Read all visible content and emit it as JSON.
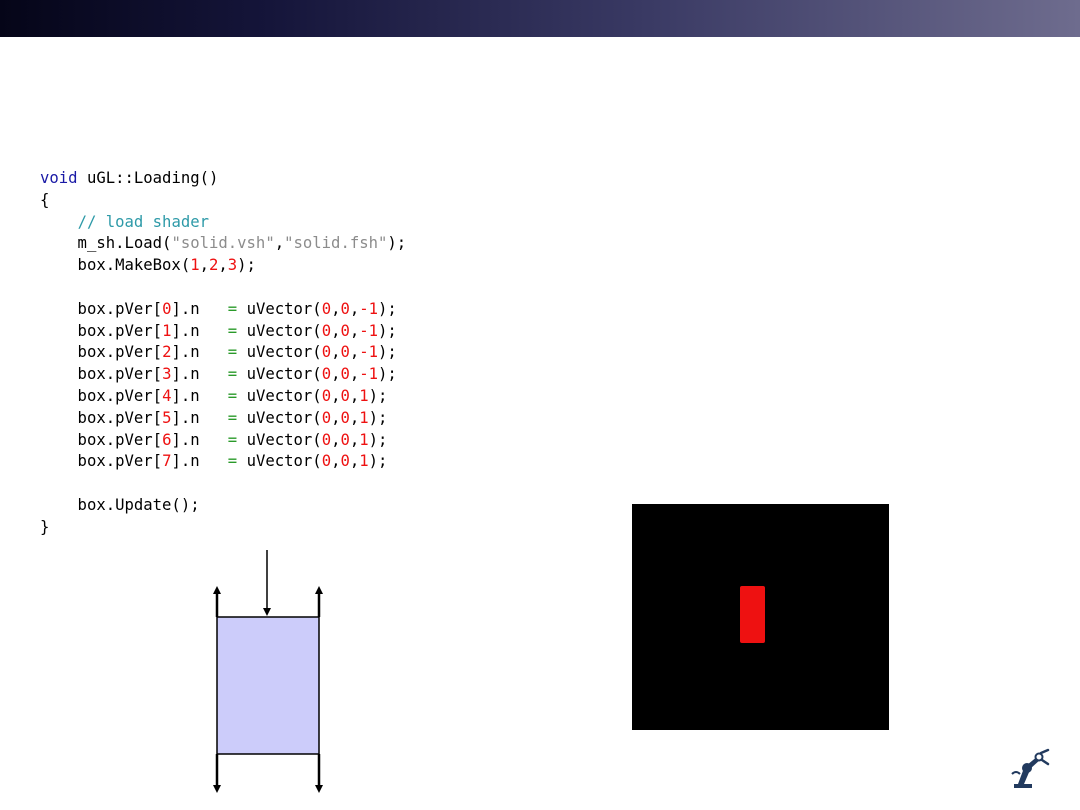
{
  "code": {
    "lines": [
      [
        {
          "t": "void",
          "c": "keyword"
        },
        {
          "t": " uGL::Loading()",
          "c": "plain"
        }
      ],
      [
        {
          "t": "{",
          "c": "plain"
        }
      ],
      [
        {
          "t": "    ",
          "c": "plain"
        },
        {
          "t": "// load shader",
          "c": "comment"
        }
      ],
      [
        {
          "t": "    m_sh.Load(",
          "c": "plain"
        },
        {
          "t": "\"solid.vsh\"",
          "c": "string"
        },
        {
          "t": ",",
          "c": "plain"
        },
        {
          "t": "\"solid.fsh\"",
          "c": "string"
        },
        {
          "t": ");",
          "c": "plain"
        }
      ],
      [
        {
          "t": "    box.MakeBox(",
          "c": "plain"
        },
        {
          "t": "1",
          "c": "number"
        },
        {
          "t": ",",
          "c": "plain"
        },
        {
          "t": "2",
          "c": "number"
        },
        {
          "t": ",",
          "c": "plain"
        },
        {
          "t": "3",
          "c": "number"
        },
        {
          "t": ");",
          "c": "plain"
        }
      ],
      [],
      [
        {
          "t": "    box.pVer[",
          "c": "plain"
        },
        {
          "t": "0",
          "c": "number"
        },
        {
          "t": "].n   ",
          "c": "plain"
        },
        {
          "t": "=",
          "c": "operator"
        },
        {
          "t": " uVector(",
          "c": "plain"
        },
        {
          "t": "0",
          "c": "number"
        },
        {
          "t": ",",
          "c": "plain"
        },
        {
          "t": "0",
          "c": "number"
        },
        {
          "t": ",",
          "c": "plain"
        },
        {
          "t": "-1",
          "c": "number"
        },
        {
          "t": ");",
          "c": "plain"
        }
      ],
      [
        {
          "t": "    box.pVer[",
          "c": "plain"
        },
        {
          "t": "1",
          "c": "number"
        },
        {
          "t": "].n   ",
          "c": "plain"
        },
        {
          "t": "=",
          "c": "operator"
        },
        {
          "t": " uVector(",
          "c": "plain"
        },
        {
          "t": "0",
          "c": "number"
        },
        {
          "t": ",",
          "c": "plain"
        },
        {
          "t": "0",
          "c": "number"
        },
        {
          "t": ",",
          "c": "plain"
        },
        {
          "t": "-1",
          "c": "number"
        },
        {
          "t": ");",
          "c": "plain"
        }
      ],
      [
        {
          "t": "    box.pVer[",
          "c": "plain"
        },
        {
          "t": "2",
          "c": "number"
        },
        {
          "t": "].n   ",
          "c": "plain"
        },
        {
          "t": "=",
          "c": "operator"
        },
        {
          "t": " uVector(",
          "c": "plain"
        },
        {
          "t": "0",
          "c": "number"
        },
        {
          "t": ",",
          "c": "plain"
        },
        {
          "t": "0",
          "c": "number"
        },
        {
          "t": ",",
          "c": "plain"
        },
        {
          "t": "-1",
          "c": "number"
        },
        {
          "t": ");",
          "c": "plain"
        }
      ],
      [
        {
          "t": "    box.pVer[",
          "c": "plain"
        },
        {
          "t": "3",
          "c": "number"
        },
        {
          "t": "].n   ",
          "c": "plain"
        },
        {
          "t": "=",
          "c": "operator"
        },
        {
          "t": " uVector(",
          "c": "plain"
        },
        {
          "t": "0",
          "c": "number"
        },
        {
          "t": ",",
          "c": "plain"
        },
        {
          "t": "0",
          "c": "number"
        },
        {
          "t": ",",
          "c": "plain"
        },
        {
          "t": "-1",
          "c": "number"
        },
        {
          "t": ");",
          "c": "plain"
        }
      ],
      [
        {
          "t": "    box.pVer[",
          "c": "plain"
        },
        {
          "t": "4",
          "c": "number"
        },
        {
          "t": "].n   ",
          "c": "plain"
        },
        {
          "t": "=",
          "c": "operator"
        },
        {
          "t": " uVector(",
          "c": "plain"
        },
        {
          "t": "0",
          "c": "number"
        },
        {
          "t": ",",
          "c": "plain"
        },
        {
          "t": "0",
          "c": "number"
        },
        {
          "t": ",",
          "c": "plain"
        },
        {
          "t": "1",
          "c": "number"
        },
        {
          "t": ");",
          "c": "plain"
        }
      ],
      [
        {
          "t": "    box.pVer[",
          "c": "plain"
        },
        {
          "t": "5",
          "c": "number"
        },
        {
          "t": "].n   ",
          "c": "plain"
        },
        {
          "t": "=",
          "c": "operator"
        },
        {
          "t": " uVector(",
          "c": "plain"
        },
        {
          "t": "0",
          "c": "number"
        },
        {
          "t": ",",
          "c": "plain"
        },
        {
          "t": "0",
          "c": "number"
        },
        {
          "t": ",",
          "c": "plain"
        },
        {
          "t": "1",
          "c": "number"
        },
        {
          "t": ");",
          "c": "plain"
        }
      ],
      [
        {
          "t": "    box.pVer[",
          "c": "plain"
        },
        {
          "t": "6",
          "c": "number"
        },
        {
          "t": "].n   ",
          "c": "plain"
        },
        {
          "t": "=",
          "c": "operator"
        },
        {
          "t": " uVector(",
          "c": "plain"
        },
        {
          "t": "0",
          "c": "number"
        },
        {
          "t": ",",
          "c": "plain"
        },
        {
          "t": "0",
          "c": "number"
        },
        {
          "t": ",",
          "c": "plain"
        },
        {
          "t": "1",
          "c": "number"
        },
        {
          "t": ");",
          "c": "plain"
        }
      ],
      [
        {
          "t": "    box.pVer[",
          "c": "plain"
        },
        {
          "t": "7",
          "c": "number"
        },
        {
          "t": "].n   ",
          "c": "plain"
        },
        {
          "t": "=",
          "c": "operator"
        },
        {
          "t": " uVector(",
          "c": "plain"
        },
        {
          "t": "0",
          "c": "number"
        },
        {
          "t": ",",
          "c": "plain"
        },
        {
          "t": "0",
          "c": "number"
        },
        {
          "t": ",",
          "c": "plain"
        },
        {
          "t": "1",
          "c": "number"
        },
        {
          "t": ");",
          "c": "plain"
        }
      ],
      [],
      [
        {
          "t": "    box.Update();",
          "c": "plain"
        }
      ],
      [
        {
          "t": "}",
          "c": "plain"
        }
      ]
    ]
  },
  "colors": {
    "keyword": "#1a1aa6",
    "comment": "#2e9aa8",
    "string": "#8c8c8c",
    "number": "#ee1111",
    "operator": "#2a9a2a",
    "plain": "#000000",
    "box_fill": "#ccccfa",
    "render_box": "#ee1111"
  },
  "icons": {
    "logo": "robot-arm-icon"
  }
}
